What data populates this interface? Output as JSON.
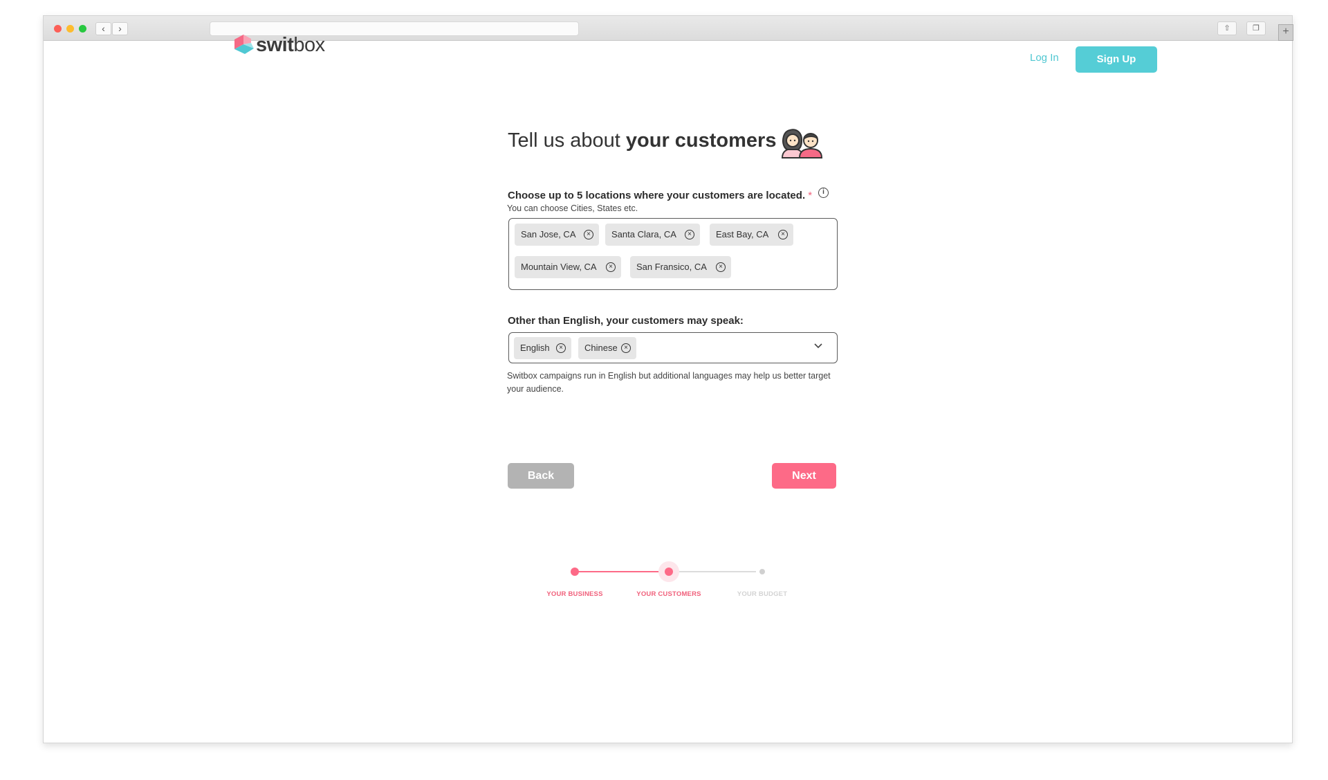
{
  "browser": {
    "back_glyph": "‹",
    "forward_glyph": "›",
    "share_glyph": "⇧",
    "tabs_glyph": "❐",
    "new_tab_glyph": "+"
  },
  "header": {
    "logo_text_regular": "swit",
    "logo_text_light": "box",
    "login_label": "Log In",
    "signup_label": "Sign Up"
  },
  "heading": {
    "prefix": "Tell us about ",
    "bold": "your customers"
  },
  "locations": {
    "label": "Choose up to 5 locations where your customers are located.",
    "required_mark": "*",
    "info_glyph": "i",
    "hint": "You can choose Cities, States etc.",
    "chips": [
      "San Jose, CA",
      "Santa Clara, CA",
      "East Bay, CA",
      "Mountain View, CA",
      "San Fransico, CA"
    ],
    "remove_glyph": "×"
  },
  "languages": {
    "label": "Other than English, your customers may speak:",
    "chips": [
      "English",
      "Chinese"
    ],
    "helper": "Switbox campaigns run in English but additional languages may help us better target your audience."
  },
  "actions": {
    "back_label": "Back",
    "next_label": "Next"
  },
  "progress": {
    "steps": [
      "YOUR BUSINESS",
      "YOUR CUSTOMERS",
      "YOUR BUDGET"
    ],
    "current_step": 2
  },
  "colors": {
    "accent_teal": "#55cdd6",
    "accent_pink": "#fd6a87",
    "inactive_grey": "#d0d0d0"
  }
}
